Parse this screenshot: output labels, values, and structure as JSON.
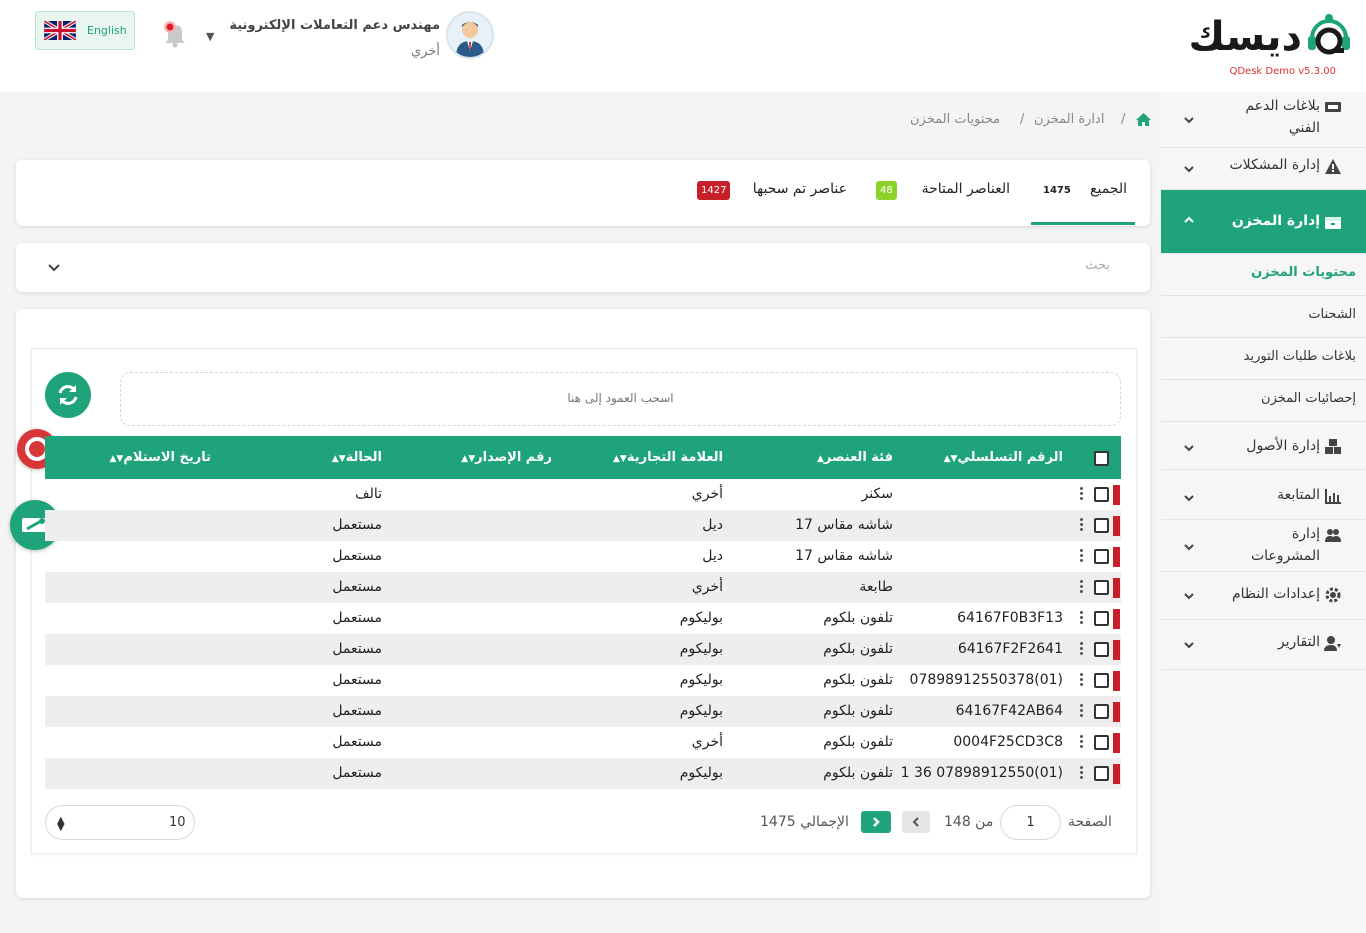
{
  "brand": {
    "logo_text": "ديسك",
    "version": "QDesk Demo v5.3.00"
  },
  "header": {
    "user_name": "مهندس دعم التعاملات الإلكترونية",
    "user_role": "أخري",
    "language_label": "English"
  },
  "sidebar": {
    "items": [
      {
        "label": "بلاغات الدعم الفني",
        "icon": "ticket-icon"
      },
      {
        "label": "إدارة المشكلات",
        "icon": "warning-icon"
      },
      {
        "label": "إدارة المخزن",
        "icon": "box-icon"
      },
      {
        "label": "إدارة الأصول",
        "icon": "cubes-icon"
      },
      {
        "label": "المتابعة",
        "icon": "chart-icon"
      },
      {
        "label": "إدارة المشروعات",
        "icon": "users-icon"
      },
      {
        "label": "إعدادات النظام",
        "icon": "gear-icon"
      },
      {
        "label": "التقارير",
        "icon": "user-report-icon"
      }
    ],
    "subitems": [
      "محتويات المخزن",
      "الشحنات",
      "بلاغات طلبات التوريد",
      "إحصائيات المخزن"
    ]
  },
  "breadcrumb": {
    "level1": "ادارة المخزن",
    "level2": "محتويات المخزن",
    "sep": "/"
  },
  "tabs": [
    {
      "label": "الجميع",
      "count": "1475"
    },
    {
      "label": "العناصر المتاحة",
      "count": "48"
    },
    {
      "label": "عناصر تم سحبها",
      "count": "1427"
    }
  ],
  "search": {
    "placeholder": "بحث"
  },
  "grid": {
    "dropzone_text": "اسحب العمود إلى هنا",
    "columns": [
      "الرقم التسلسلي",
      "فئة العنصر",
      "العلامة التجارية",
      "رقم الإصدار",
      "الحالة",
      "تاريخ الاستلام"
    ],
    "rows": [
      {
        "serial": "",
        "category": "سكنر",
        "brand": "أخري",
        "version": "",
        "status": "تالف",
        "date": ""
      },
      {
        "serial": "",
        "category": "شاشه مقاس 17",
        "brand": "ديل",
        "version": "",
        "status": "مستعمل",
        "date": ""
      },
      {
        "serial": "",
        "category": "شاشه مقاس 17",
        "brand": "ديل",
        "version": "",
        "status": "مستعمل",
        "date": ""
      },
      {
        "serial": "",
        "category": "طابعة",
        "brand": "أخري",
        "version": "",
        "status": "مستعمل",
        "date": ""
      },
      {
        "serial": "64167F0B3F13",
        "category": "تلفون بلكوم",
        "brand": "بوليكوم",
        "version": "",
        "status": "مستعمل",
        "date": ""
      },
      {
        "serial": "64167F2F2641",
        "category": "تلفون بلكوم",
        "brand": "بوليكوم",
        "version": "",
        "status": "مستعمل",
        "date": ""
      },
      {
        "serial": "07898912550378(01)",
        "category": "تلفون بلكوم",
        "brand": "بوليكوم",
        "version": "",
        "status": "مستعمل",
        "date": ""
      },
      {
        "serial": "64167F42AB64",
        "category": "تلفون بلكوم",
        "brand": "بوليكوم",
        "version": "",
        "status": "مستعمل",
        "date": ""
      },
      {
        "serial": "0004F25CD3C8",
        "category": "تلفون بلكوم",
        "brand": "أخري",
        "version": "",
        "status": "مستعمل",
        "date": ""
      },
      {
        "serial": "1 36 07898912550(01)",
        "category": "تلفون بلكوم",
        "brand": "بوليكوم",
        "version": "",
        "status": "مستعمل",
        "date": ""
      }
    ]
  },
  "pager": {
    "page_label": "الصفحة",
    "page_value": "1",
    "of_label": "من 148",
    "total_label": "الإجمالي 1475",
    "page_size": "10"
  },
  "colors": {
    "accent": "#1fa37a",
    "danger": "#c8202a",
    "badge_green": "#8bd32b"
  }
}
